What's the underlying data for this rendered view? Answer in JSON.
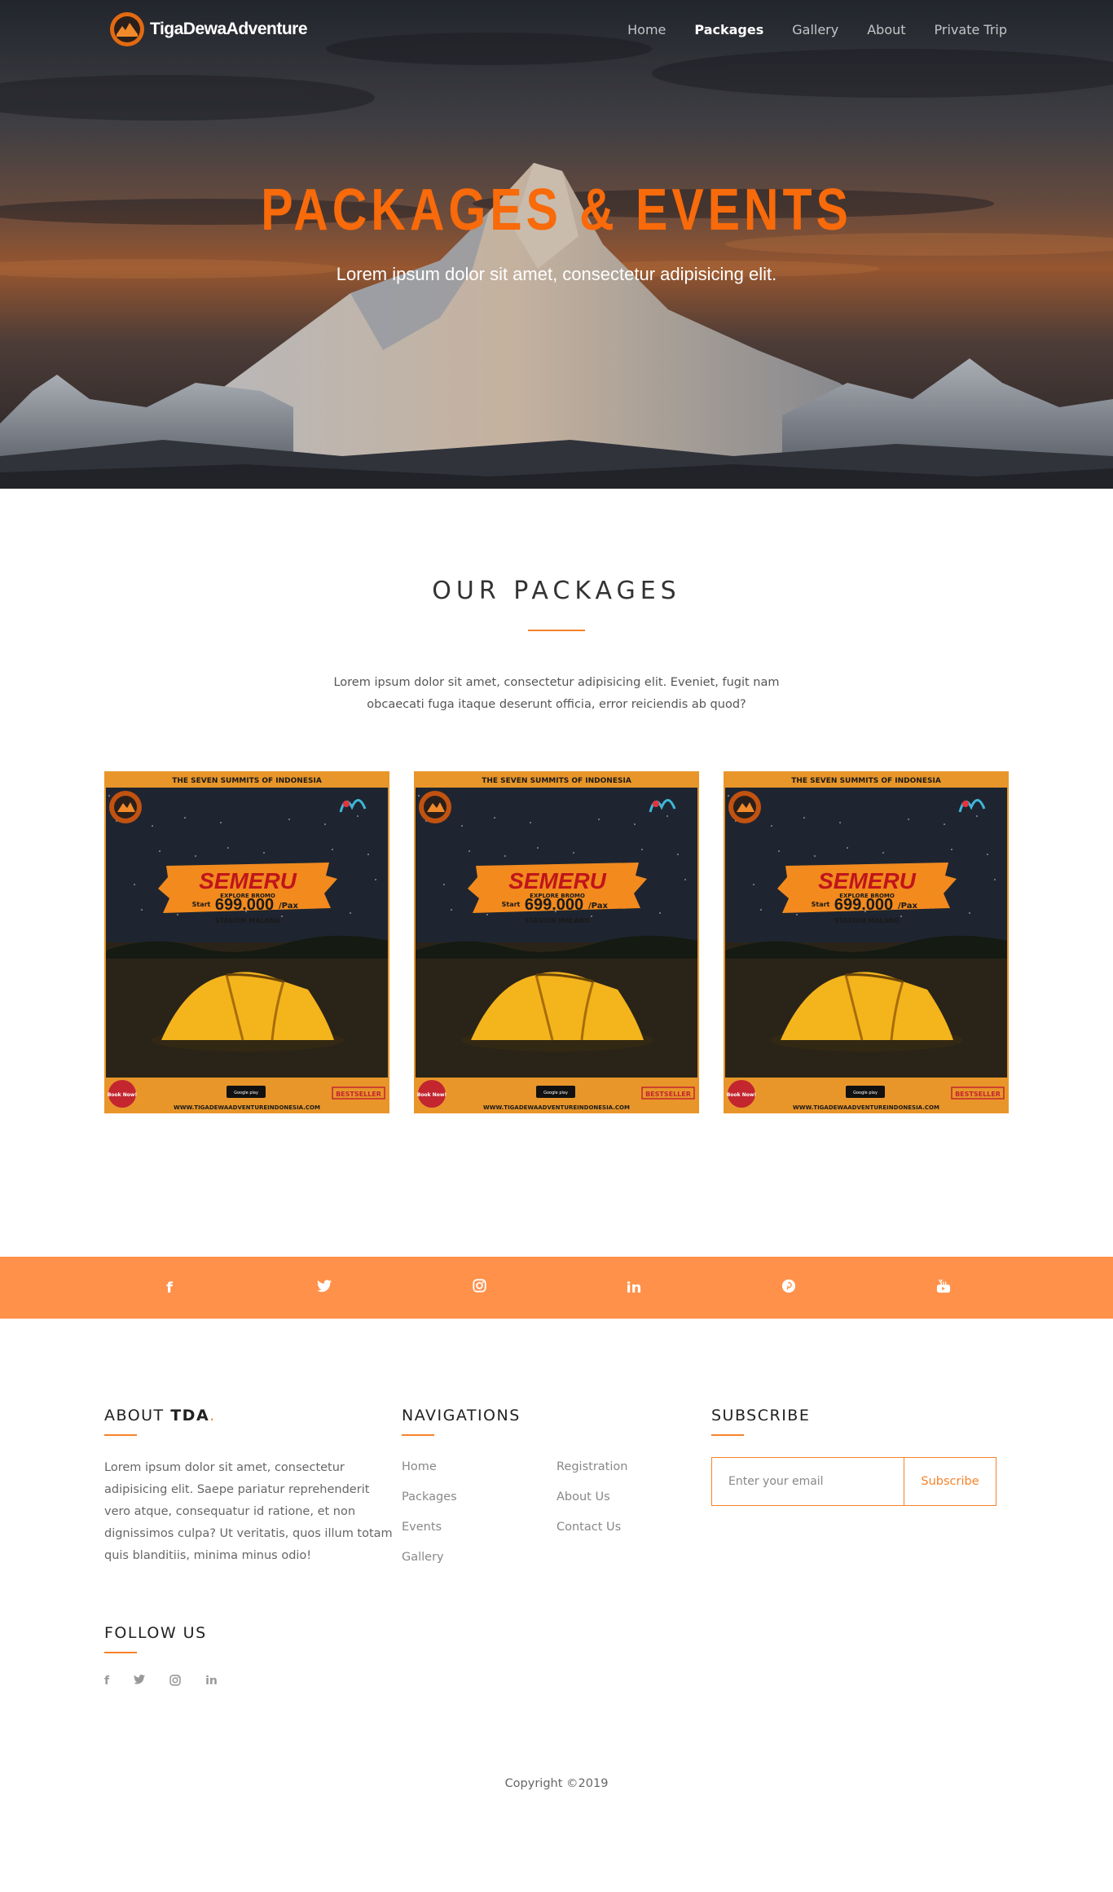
{
  "nav": {
    "brand": "TigaDewaAdventure",
    "items": [
      {
        "label": "Home",
        "active": false
      },
      {
        "label": "Packages",
        "active": true
      },
      {
        "label": "Gallery",
        "active": false
      },
      {
        "label": "About",
        "active": false
      },
      {
        "label": "Private Trip",
        "active": false
      }
    ]
  },
  "hero": {
    "title": "PACKAGES & EVENTS",
    "subtitle": "Lorem ipsum dolor sit amet, consectetur adipisicing elit."
  },
  "packages": {
    "title": "OUR PACKAGES",
    "description": "Lorem ipsum dolor sit amet, consectetur adipisicing elit. Eveniet, fugit nam obcaecati fuga itaque deserunt officia, error reiciendis ab quod?",
    "cards": [
      {
        "banner": "THE SEVEN SUMMITS OF INDONESIA",
        "mountain": "SEMERU",
        "tag": "EXPLORE BROMO",
        "start_label": "Start",
        "price": "699.000",
        "unit": "/Pax",
        "station": "STASIUN MALANG",
        "badge": "Book Now!",
        "store": "Google play",
        "bestseller": "BESTSELLER",
        "website": "WWW.TIGADEWAADVENTUREINDONESIA.COM"
      },
      {
        "banner": "THE SEVEN SUMMITS OF INDONESIA",
        "mountain": "SEMERU",
        "tag": "EXPLORE BROMO",
        "start_label": "Start",
        "price": "699.000",
        "unit": "/Pax",
        "station": "STASIUN MALANG",
        "badge": "Book Now!",
        "store": "Google play",
        "bestseller": "BESTSELLER",
        "website": "WWW.TIGADEWAADVENTUREINDONESIA.COM"
      },
      {
        "banner": "THE SEVEN SUMMITS OF INDONESIA",
        "mountain": "SEMERU",
        "tag": "EXPLORE BROMO",
        "start_label": "Start",
        "price": "699.000",
        "unit": "/Pax",
        "station": "STASIUN MALANG",
        "badge": "Book Now!",
        "store": "Google play",
        "bestseller": "BESTSELLER",
        "website": "WWW.TIGADEWAADVENTUREINDONESIA.COM"
      }
    ]
  },
  "social_bar": {
    "icons": [
      {
        "name": "facebook-icon",
        "glyph": "f"
      },
      {
        "name": "twitter-icon",
        "glyph": "🐦"
      },
      {
        "name": "instagram-icon",
        "glyph": "◎"
      },
      {
        "name": "linkedin-icon",
        "glyph": "in"
      },
      {
        "name": "pinterest-icon",
        "glyph": "℗"
      },
      {
        "name": "youtube-icon",
        "glyph": "▶"
      }
    ],
    "color": "#ff914a"
  },
  "footer": {
    "about": {
      "title_prefix": "ABOUT ",
      "title_bold": "TDA",
      "title_dot": ".",
      "text": "Lorem ipsum dolor sit amet, consectetur adipisicing elit. Saepe pariatur reprehenderit vero atque, consequatur id ratione, et non dignissimos culpa? Ut veritatis, quos illum totam quis blanditiis, minima minus odio!"
    },
    "navigations": {
      "title": "NAVIGATIONS",
      "links": [
        "Home",
        "Registration",
        "Packages",
        "About Us",
        "Events",
        "Contact Us",
        "Gallery"
      ]
    },
    "subscribe": {
      "title": "SUBSCRIBE",
      "placeholder": "Enter your email",
      "button": "Subscribe"
    },
    "follow": {
      "title": "FOLLOW US",
      "icons": [
        {
          "name": "facebook-icon",
          "glyph": "f"
        },
        {
          "name": "twitter-icon",
          "glyph": "🐦"
        },
        {
          "name": "instagram-icon",
          "glyph": "◎"
        },
        {
          "name": "linkedin-icon",
          "glyph": "in"
        }
      ]
    },
    "copyright": "Copyright ©2019"
  },
  "colors": {
    "accent": "#f6822a",
    "hero_title": "#f86a0a"
  }
}
